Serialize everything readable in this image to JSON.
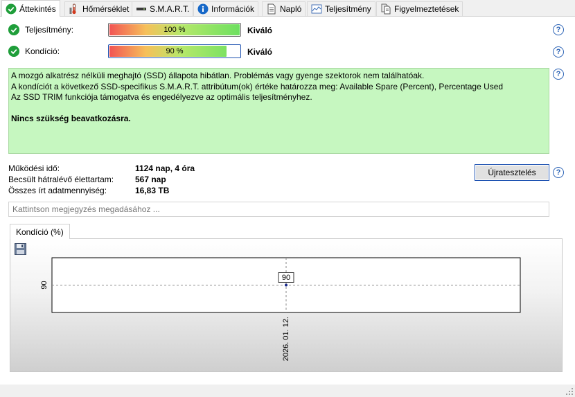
{
  "tabs": [
    {
      "label": "Áttekintés",
      "icon": "check-circle-icon",
      "active": true
    },
    {
      "label": "Hőmérséklet",
      "icon": "thermometer-icon",
      "active": false
    },
    {
      "label": "S.M.A.R.T.",
      "icon": "drive-icon",
      "active": false
    },
    {
      "label": "Információk",
      "icon": "info-icon",
      "active": false
    },
    {
      "label": "Napló",
      "icon": "document-icon",
      "active": false
    },
    {
      "label": "Teljesítmény",
      "icon": "performance-chart-icon",
      "active": false
    },
    {
      "label": "Figyelmeztetések",
      "icon": "warnings-icon",
      "active": false
    }
  ],
  "performance": {
    "label": "Teljesítmény:",
    "value": 100,
    "value_text": "100 %",
    "rating": "Kiváló"
  },
  "condition": {
    "label": "Kondíció:",
    "value": 90,
    "value_text": "90 %",
    "rating": "Kiváló"
  },
  "status": {
    "line1": "A mozgó alkatrész nélküli meghajtó (SSD) állapota hibátlan. Problémás vagy gyenge szektorok nem találhatóak.",
    "line2": "A kondíciót a következő SSD-specifikus S.M.A.R.T. attribútum(ok) értéke határozza meg:  Available Spare (Percent), Percentage Used",
    "line3": "Az SSD TRIM funkciója támogatva és engedélyezve az optimális teljesítményhez.",
    "conclusion": "Nincs szükség beavatkozásra."
  },
  "info": {
    "uptime_label": "Működési idő:",
    "uptime_value": "1124 nap, 4 óra",
    "remaining_label": "Becsült hátralévő élettartam:",
    "remaining_value": "567 nap",
    "written_label": "Összes írt adatmennyiség:",
    "written_value": "16,83 TB"
  },
  "buttons": {
    "retest": "Újratesztelés",
    "help": "?"
  },
  "note": {
    "placeholder": "Kattintson megjegyzés megadásához ..."
  },
  "chart_tab": {
    "label": "Kondíció  (%)"
  },
  "colors": {
    "ok_green": "#1f9e3a",
    "status_bg": "#c6f7c0",
    "help_blue": "#2a62b5"
  },
  "chart_data": {
    "type": "line",
    "x": [
      "2026. 01. 12."
    ],
    "series": [
      {
        "values": [
          90
        ]
      }
    ],
    "point_labels": [
      "90"
    ],
    "y_ticks": [
      90
    ],
    "x_ticks": [
      "2026. 01. 12."
    ],
    "grid": true
  }
}
